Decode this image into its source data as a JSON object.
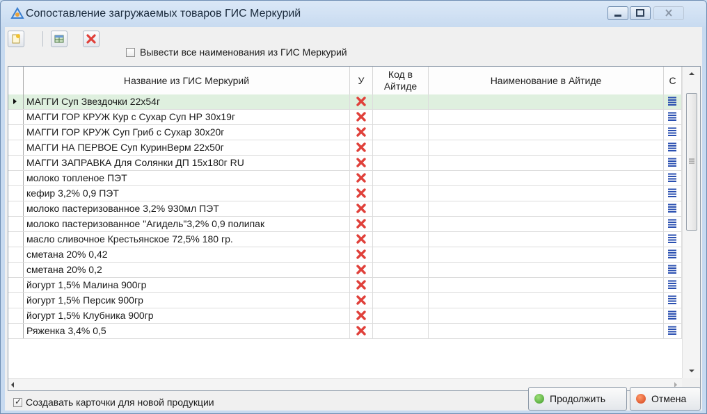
{
  "window": {
    "title": "Сопоставление загружаемых товаров ГИС Меркурий"
  },
  "toolbar": {
    "show_all_label": "Вывести все наименования из ГИС Меркурий",
    "show_all_checked": false
  },
  "grid": {
    "columns": {
      "name": "Название из ГИС Меркурий",
      "u": "У",
      "code": "Код в\nАйтиде",
      "aitida_name": "Наименование в Айтиде",
      "c": "С"
    },
    "rows": [
      {
        "name": "МАГГИ Суп Звездочки 22х54г",
        "selected": true
      },
      {
        "name": "МАГГИ ГОР КРУЖ Кур с Сухар Суп НР 30х19г"
      },
      {
        "name": "МАГГИ ГОР КРУЖ Суп Гриб с Сухар 30х20г"
      },
      {
        "name": "МАГГИ НА ПЕРВОЕ Суп КуринВерм 22х50г"
      },
      {
        "name": "МАГГИ ЗАПРАВКА Для Солянки ДП 15х180г RU"
      },
      {
        "name": "молоко топленое ПЭТ"
      },
      {
        "name": "кефир 3,2% 0,9 ПЭТ"
      },
      {
        "name": "молоко пастеризованное 3,2% 930мл ПЭТ"
      },
      {
        "name": "молоко пастеризованное \"Агидель\"3,2% 0,9 полипак"
      },
      {
        "name": "масло сливочное Крестьянское 72,5% 180 гр."
      },
      {
        "name": "сметана 20% 0,42"
      },
      {
        "name": "сметана 20% 0,2"
      },
      {
        "name": "йогурт 1,5% Малина  900гр"
      },
      {
        "name": "йогурт 1,5% Персик 900гр"
      },
      {
        "name": "йогурт 1,5% Клубника 900гр"
      },
      {
        "name": "Ряженка 3,4% 0,5"
      }
    ]
  },
  "footer": {
    "create_cards_label": "Создавать карточки для новой продукции",
    "create_cards_checked": true,
    "continue_label": "Продолжить",
    "cancel_label": "Отмена"
  },
  "colors": {
    "selected_row": "#dff0df",
    "delete_icon": "#e0403a",
    "list_icon": "#2a4fb0"
  }
}
